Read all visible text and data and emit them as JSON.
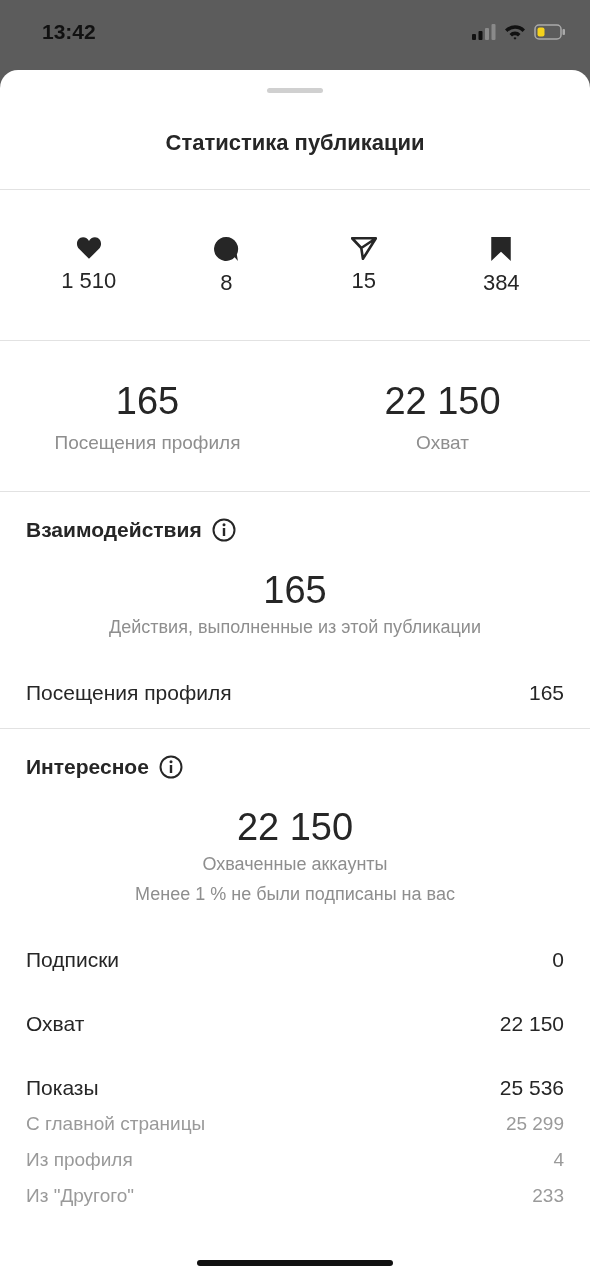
{
  "status_bar": {
    "time": "13:42"
  },
  "sheet": {
    "title": "Статистика публикации"
  },
  "actions": [
    {
      "kind": "like",
      "value": "1 510"
    },
    {
      "kind": "comment",
      "value": "8"
    },
    {
      "kind": "share",
      "value": "15"
    },
    {
      "kind": "save",
      "value": "384"
    }
  ],
  "summary": [
    {
      "value": "165",
      "label": "Посещения профиля"
    },
    {
      "value": "22 150",
      "label": "Охват"
    }
  ],
  "sections": [
    {
      "title": "Взаимодействия",
      "big_value": "165",
      "captions": [
        "Действия, выполненные из этой публикации"
      ],
      "rows": [
        {
          "kind": "main",
          "label": "Посещения профиля",
          "value": "165"
        }
      ]
    },
    {
      "title": "Интересное",
      "big_value": "22 150",
      "captions": [
        "Охваченные аккаунты",
        "Менее 1 % не были подписаны на вас"
      ],
      "rows": [
        {
          "kind": "main",
          "label": "Подписки",
          "value": "0"
        },
        {
          "kind": "main",
          "label": "Охват",
          "value": "22 150"
        },
        {
          "kind": "main",
          "label": "Показы",
          "value": "25 536"
        },
        {
          "kind": "sub",
          "label": "С главной страницы",
          "value": "25 299"
        },
        {
          "kind": "sub",
          "label": "Из профиля",
          "value": "4"
        },
        {
          "kind": "sub",
          "label": "Из \"Другого\"",
          "value": "233"
        }
      ]
    }
  ]
}
